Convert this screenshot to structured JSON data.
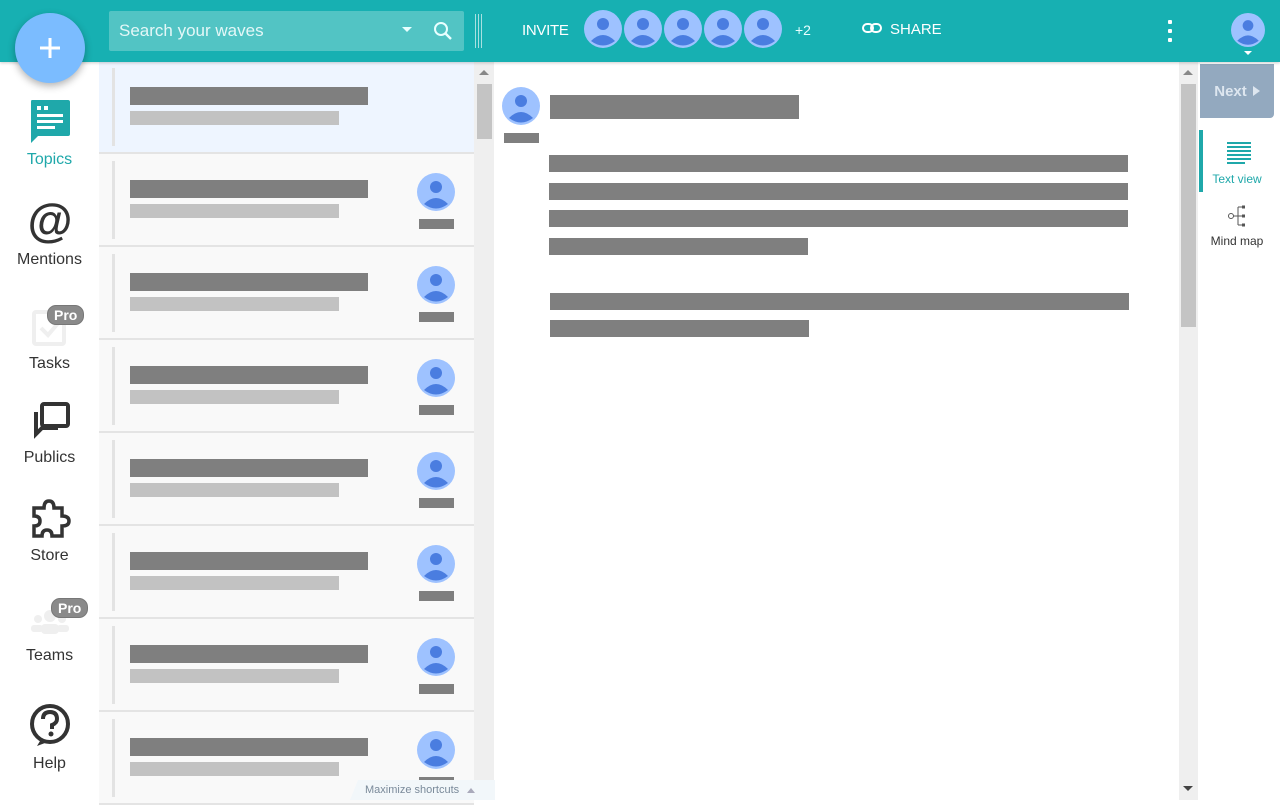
{
  "colors": {
    "topbar": "#17b0b2",
    "accent": "#1fa8aa",
    "fab": "#7bbcff",
    "avatar_bg": "#9ec2ff",
    "avatar_fg": "#4a7de0"
  },
  "header": {
    "fab_icon": "plus-icon",
    "search": {
      "placeholder": "Search your waves",
      "value": ""
    },
    "invite_label": "INVITE",
    "participant_count": 5,
    "extra_participants": "+2",
    "share_label": "SHARE"
  },
  "sidebar": {
    "items": [
      {
        "label": "Topics",
        "icon": "topics-icon",
        "active": true,
        "pro": false
      },
      {
        "label": "Mentions",
        "icon": "at-icon",
        "active": false,
        "pro": false
      },
      {
        "label": "Tasks",
        "icon": "tasks-icon",
        "active": false,
        "pro": true
      },
      {
        "label": "Publics",
        "icon": "publics-icon",
        "active": false,
        "pro": false
      },
      {
        "label": "Store",
        "icon": "puzzle-icon",
        "active": false,
        "pro": false
      },
      {
        "label": "Teams",
        "icon": "teams-icon",
        "active": false,
        "pro": true
      },
      {
        "label": "Help",
        "icon": "help-icon",
        "active": false,
        "pro": false
      }
    ],
    "pro_badge": "Pro"
  },
  "wave_list": {
    "item_count": 8,
    "selected_index": 0,
    "maximize_shortcuts_label": "Maximize shortcuts"
  },
  "right_panel": {
    "next_label": "Next",
    "views": [
      {
        "label": "Text view",
        "icon": "text-view-icon",
        "active": true
      },
      {
        "label": "Mind map",
        "icon": "mind-map-icon",
        "active": false
      }
    ]
  }
}
